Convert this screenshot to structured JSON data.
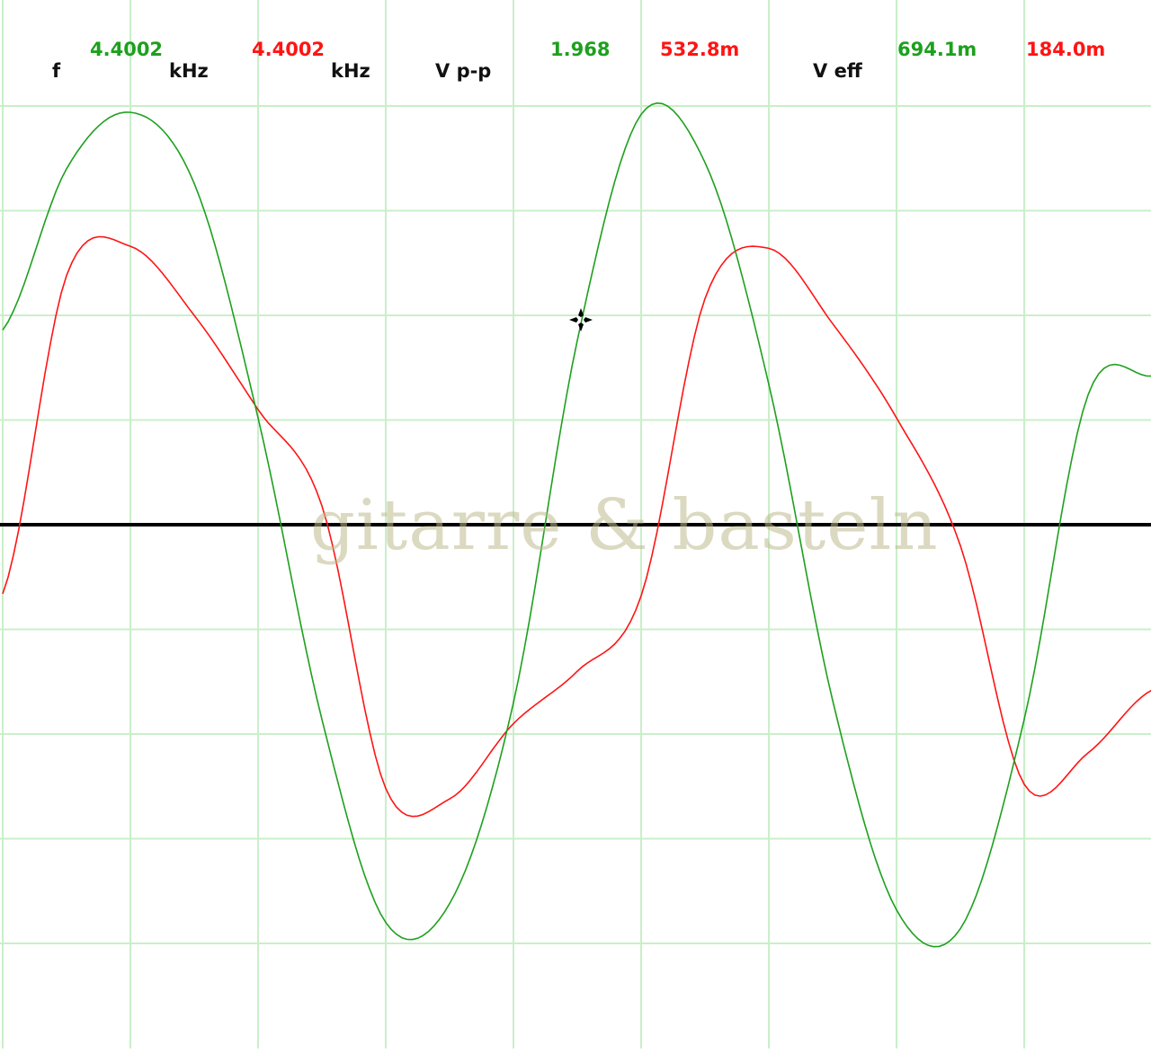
{
  "readout": {
    "freq_label": "f",
    "freq_ch1": "4.4002",
    "freq_unit_1": "kHz",
    "freq_ch2": "4.4002",
    "freq_unit_2": "kHz",
    "vpp_label": "V p-p",
    "vpp_ch1": "1.968",
    "vpp_ch2": "532.8m",
    "veff_label": "V eff",
    "veff_ch1": "694.1m",
    "veff_ch2": "184.0m"
  },
  "watermark": "gitarre & basteln",
  "colors": {
    "ch1": "#1ea01e",
    "ch2": "#ff1414",
    "label": "#111111",
    "grid": "#c9efc9",
    "zero_line": "#000000"
  },
  "chart_data": {
    "type": "line",
    "grid": true,
    "x_divisions": 9,
    "y_divisions": 8,
    "x": [
      0,
      0.5,
      1,
      1.5,
      2,
      2.5,
      3,
      3.5,
      4,
      4.5,
      5,
      5.5,
      6,
      6.5,
      7,
      7.5,
      8,
      8.5,
      9
    ],
    "series": [
      {
        "color": "#1ea01e",
        "values": [
          1.86,
          3.4,
          3.94,
          3.26,
          1.02,
          -1.86,
          -3.8,
          -3.62,
          -1.7,
          1.76,
          3.92,
          3.46,
          1.34,
          -1.68,
          -3.68,
          -3.86,
          -1.86,
          1.24,
          1.42
        ]
      },
      {
        "color": "#ff1414",
        "values": [
          -0.66,
          2.38,
          2.66,
          2.0,
          1.1,
          0.18,
          -2.52,
          -2.62,
          -1.9,
          -1.4,
          -0.68,
          2.16,
          2.64,
          1.92,
          1.02,
          -0.2,
          -2.48,
          -2.18,
          -1.58
        ]
      }
    ]
  }
}
